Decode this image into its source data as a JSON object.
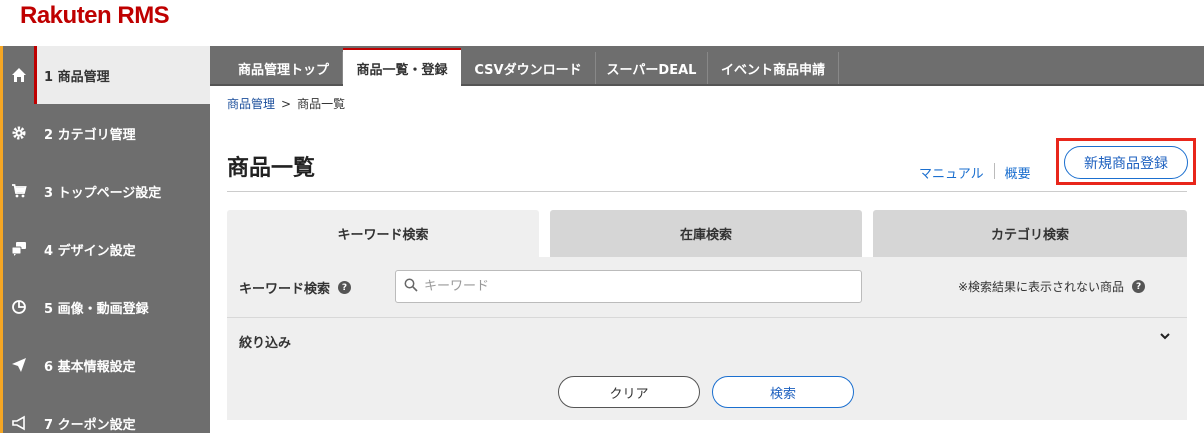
{
  "app": {
    "logo": "Rakuten RMS"
  },
  "sidebar": {
    "items": [
      {
        "label": "1 商品管理",
        "icon": "home-icon"
      },
      {
        "label": "2 カテゴリ管理",
        "icon": "gear-icon"
      },
      {
        "label": "3 トップページ設定",
        "icon": "cart-icon"
      },
      {
        "label": "4 デザイン設定",
        "icon": "chat-icon"
      },
      {
        "label": "5 画像・動画登録",
        "icon": "pie-chart-icon"
      },
      {
        "label": "6 基本情報設定",
        "icon": "paper-plane-icon"
      },
      {
        "label": "7 クーポン設定",
        "icon": "megaphone-icon"
      }
    ],
    "active_index": 0
  },
  "topnav": {
    "tabs": [
      "商品管理トップ",
      "商品一覧・登録",
      "CSVダウンロード",
      "スーパーDEAL",
      "イベント商品申請"
    ],
    "active_index": 1
  },
  "breadcrumb": {
    "parent": "商品管理",
    "separator": ">",
    "current": "商品一覧"
  },
  "page": {
    "title": "商品一覧",
    "manual_link": "マニュアル",
    "overview_link": "概要",
    "register_button": "新規商品登録"
  },
  "search_tabs": {
    "items": [
      "キーワード検索",
      "在庫検索",
      "カテゴリ検索"
    ],
    "active_index": 0
  },
  "search_panel": {
    "keyword_label": "キーワード検索",
    "keyword_placeholder": "キーワード",
    "keyword_value": "",
    "hidden_items_note": "※検索結果に表示されない商品",
    "filter_label": "絞り込み",
    "clear_button": "クリア",
    "search_button": "検索"
  },
  "colors": {
    "brand": "#bf0000",
    "link": "#1b6fcf",
    "highlight_frame": "#e8261b",
    "sidebar_bg": "#6e6e6e"
  }
}
